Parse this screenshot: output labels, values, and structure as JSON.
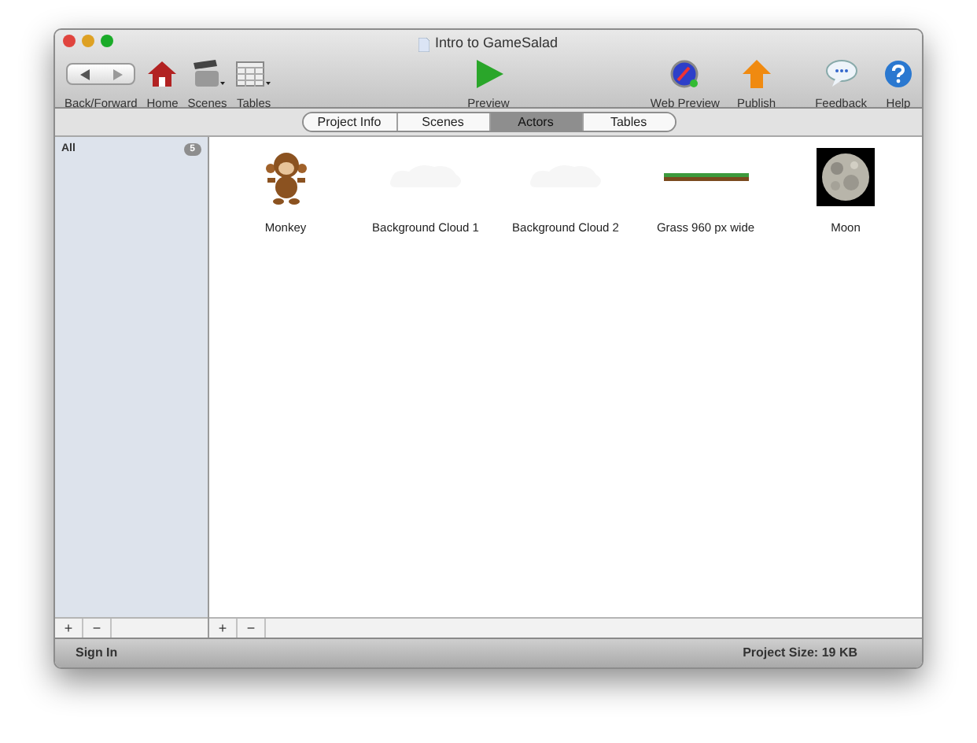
{
  "window": {
    "title": "Intro to GameSalad"
  },
  "toolbar_left": [
    {
      "kind": "backforward",
      "label": "Back/Forward"
    },
    {
      "kind": "home",
      "label": "Home"
    },
    {
      "kind": "scenes",
      "label": "Scenes"
    },
    {
      "kind": "tables",
      "label": "Tables"
    }
  ],
  "toolbar_center": [
    {
      "kind": "preview",
      "label": "Preview"
    }
  ],
  "toolbar_right": [
    {
      "kind": "webpreview",
      "label": "Web Preview"
    },
    {
      "kind": "publish",
      "label": "Publish"
    },
    {
      "kind": "feedback",
      "label": "Feedback"
    },
    {
      "kind": "help",
      "label": "Help"
    }
  ],
  "tabs": [
    {
      "label": "Project Info",
      "selected": false
    },
    {
      "label": "Scenes",
      "selected": false
    },
    {
      "label": "Actors",
      "selected": true
    },
    {
      "label": "Tables",
      "selected": false
    }
  ],
  "sidebar": {
    "items": [
      {
        "label": "All",
        "count": "5"
      }
    ],
    "buttons": [
      "+",
      "−"
    ]
  },
  "actors": [
    {
      "kind": "monkey",
      "name": "Monkey"
    },
    {
      "kind": "cloud",
      "name": "Background Cloud 1"
    },
    {
      "kind": "cloud",
      "name": "Background Cloud 2"
    },
    {
      "kind": "grass",
      "name": "Grass 960 px wide"
    },
    {
      "kind": "moon",
      "name": "Moon"
    }
  ],
  "content_buttons": [
    "+",
    "−"
  ],
  "status_bar": {
    "left": "Sign In",
    "right": "Project Size: 19 KB"
  }
}
